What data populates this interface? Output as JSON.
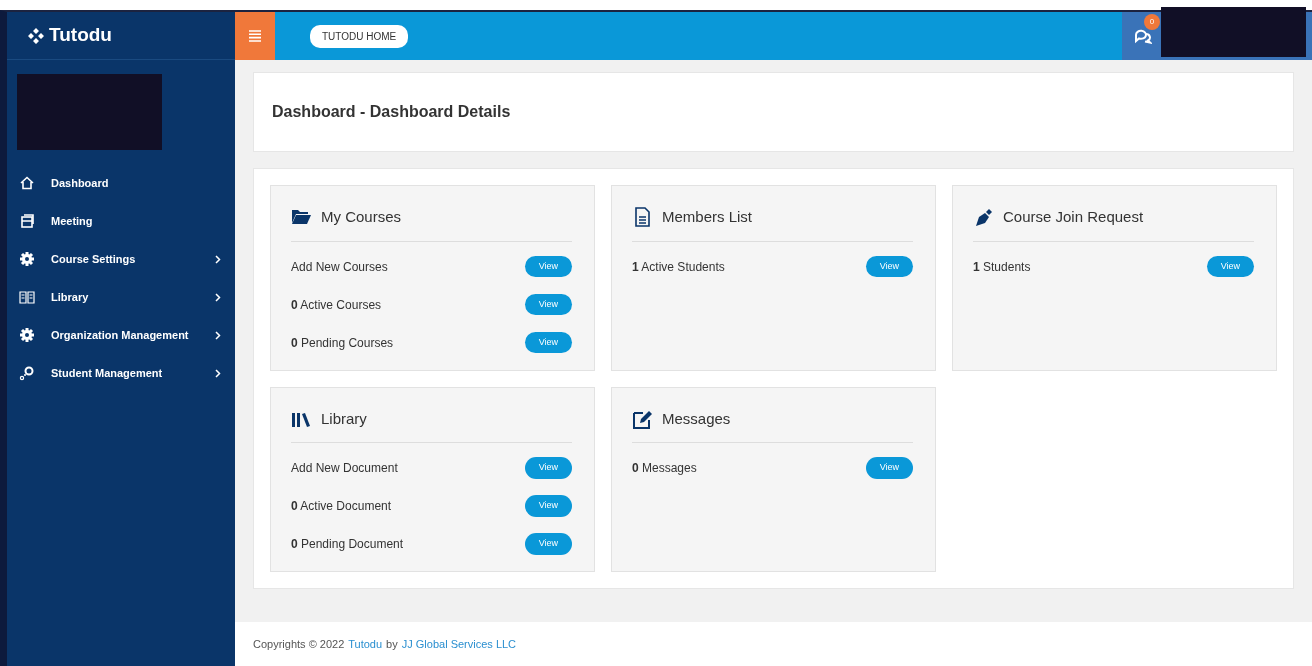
{
  "brand": {
    "name": "Tutodu"
  },
  "sidebar": {
    "items": [
      {
        "label": "Dashboard",
        "kind": "home",
        "submenu": false
      },
      {
        "label": "Meeting",
        "kind": "meeting",
        "submenu": false
      },
      {
        "label": "Course Settings",
        "kind": "gear",
        "submenu": true
      },
      {
        "label": "Library",
        "kind": "book",
        "submenu": true
      },
      {
        "label": "Organization Management",
        "kind": "gear",
        "submenu": true
      },
      {
        "label": "Student Management",
        "kind": "key",
        "submenu": true
      }
    ]
  },
  "topbar": {
    "home_button": "TUTODU HOME",
    "chat_badge": "0"
  },
  "page_title": "Dashboard - Dashboard Details",
  "cards": [
    {
      "title": "My Courses",
      "kind": "folder",
      "rows": [
        {
          "text": "Add New Courses",
          "button": "View"
        },
        {
          "text": "**0** Active Courses",
          "button": "View"
        },
        {
          "text": "**0** Pending Courses",
          "button": "View"
        }
      ]
    },
    {
      "title": "Members List",
      "kind": "document",
      "rows": [
        {
          "text": "**1** Active Students",
          "button": "View"
        }
      ]
    },
    {
      "title": "Course Join Request",
      "kind": "pen",
      "rows": [
        {
          "text": "**1** Students",
          "button": "View"
        }
      ]
    },
    {
      "title": "Library",
      "kind": "books",
      "rows": [
        {
          "text": "Add New Document",
          "button": "View"
        },
        {
          "text": "**0** Active Document",
          "button": "View"
        },
        {
          "text": "**0** Pending Document",
          "button": "View"
        }
      ]
    },
    {
      "title": "Messages",
      "kind": "edit",
      "rows": [
        {
          "text": "**0** Messages",
          "button": "View"
        }
      ]
    }
  ],
  "footer": {
    "prefix": "Copyrights © 2022",
    "brand_link": "Tutodu",
    "by": "by",
    "company_link": "JJ Global Services LLC"
  }
}
